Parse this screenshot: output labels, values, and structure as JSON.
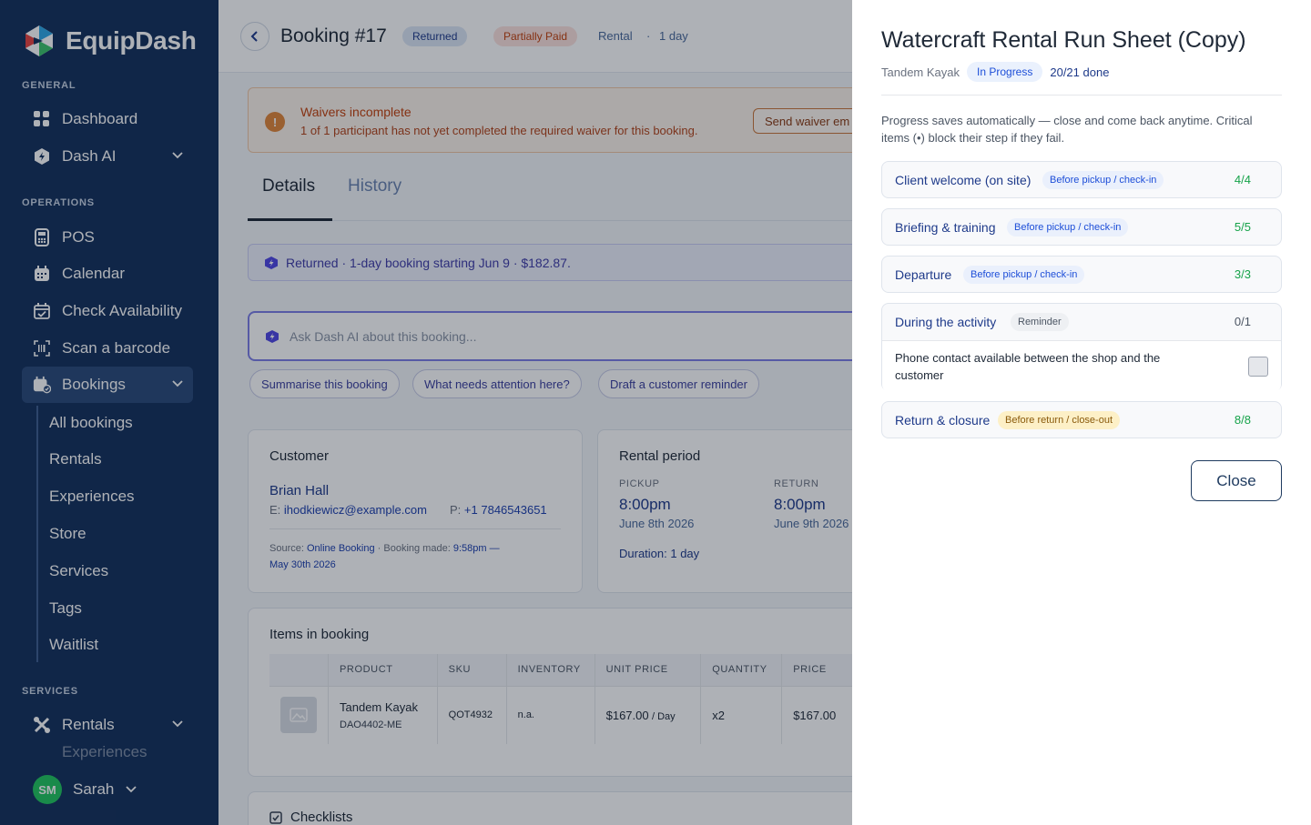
{
  "sidebar": {
    "brand": "EquipDash",
    "sections": {
      "general": "GENERAL",
      "operations": "OPERATIONS",
      "services": "SERVICES"
    },
    "items": {
      "dashboard": "Dashboard",
      "dash_ai": "Dash AI",
      "pos": "POS",
      "calendar": "Calendar",
      "check_availability": "Check Availability",
      "scan_barcode": "Scan a barcode",
      "bookings": "Bookings",
      "rentals": "Rentals",
      "experiences": "Experiences"
    },
    "bookings_sub": {
      "all_bookings": "All bookings",
      "rentals": "Rentals",
      "experiences": "Experiences",
      "store": "Store",
      "services": "Services",
      "tags": "Tags",
      "waitlist": "Waitlist"
    },
    "user": {
      "initials": "SM",
      "name": "Sarah"
    }
  },
  "booking": {
    "title": "Booking #17",
    "status": "Returned",
    "payment": "Partially Paid",
    "type": "Rental",
    "duration_meta": "1 day",
    "colors": {
      "returned_bg": "#dbe6f5",
      "returned_text": "#1e3a8a",
      "partially_paid_bg": "#fde2dd",
      "partially_paid_text": "#c2410c"
    }
  },
  "alert": {
    "title": "Waivers incomplete",
    "text": "1 of 1 participant has not yet completed the required waiver for this booking.",
    "button": "Send waiver em"
  },
  "tabs": {
    "details": "Details",
    "history": "History"
  },
  "summary": "Returned · 1-day booking starting Jun 9 · $182.87.",
  "ask": {
    "placeholder": "Ask Dash AI about this booking...",
    "chips": [
      "Summarise this booking",
      "What needs attention here?",
      "Draft a customer reminder"
    ]
  },
  "customer": {
    "title": "Customer",
    "name": "Brian Hall",
    "email_label": "E:",
    "email": "ihodkiewicz@example.com",
    "phone_label": "P:",
    "phone": "+1 7846543651",
    "source_label": "Source:",
    "source": "Online Booking",
    "made_label": "Booking made:",
    "made_time": "9:58pm —",
    "made_date": "May 30th 2026"
  },
  "rental_period": {
    "title": "Rental period",
    "pickup_label": "PICKUP",
    "pickup_time": "8:00pm",
    "pickup_date": "June 8th 2026",
    "return_label": "RETURN",
    "return_time": "8:00pm",
    "return_date": "June 9th 2026",
    "duration": "Duration: 1 day"
  },
  "items": {
    "title": "Items in booking",
    "headers": [
      "",
      "PRODUCT",
      "SKU",
      "INVENTORY",
      "UNIT PRICE",
      "QUANTITY",
      "PRICE"
    ],
    "row": {
      "product": "Tandem Kayak",
      "product_code": "DAO4402-ME",
      "sku": "QOT4932",
      "inventory": "n.a.",
      "unit_price": "$167.00",
      "unit_suffix": "/ Day",
      "quantity": "x2",
      "price": "$167.00"
    }
  },
  "checklists": {
    "title": "Checklists"
  },
  "drawer": {
    "title": "Watercraft Rental Run Sheet (Copy)",
    "asset": "Tandem Kayak",
    "status": "In Progress",
    "done": "20/21 done",
    "note": "Progress saves automatically — close and come back anytime. Critical items (•) block their step if they fail.",
    "steps": [
      {
        "name": "Client welcome (on site)",
        "tag": "Before pickup / check-in",
        "count": "4/4"
      },
      {
        "name": "Briefing & training",
        "tag": "Before pickup / check-in",
        "count": "5/5"
      },
      {
        "name": "Departure",
        "tag": "Before pickup / check-in",
        "count": "3/3"
      },
      {
        "name": "During the activity",
        "tag": "Reminder",
        "count": "0/1",
        "item": "Phone contact available between the shop and the customer",
        "checked": false
      },
      {
        "name": "Return & closure",
        "tag": "Before return / close-out",
        "count": "8/8"
      }
    ],
    "close_label": "Close"
  }
}
